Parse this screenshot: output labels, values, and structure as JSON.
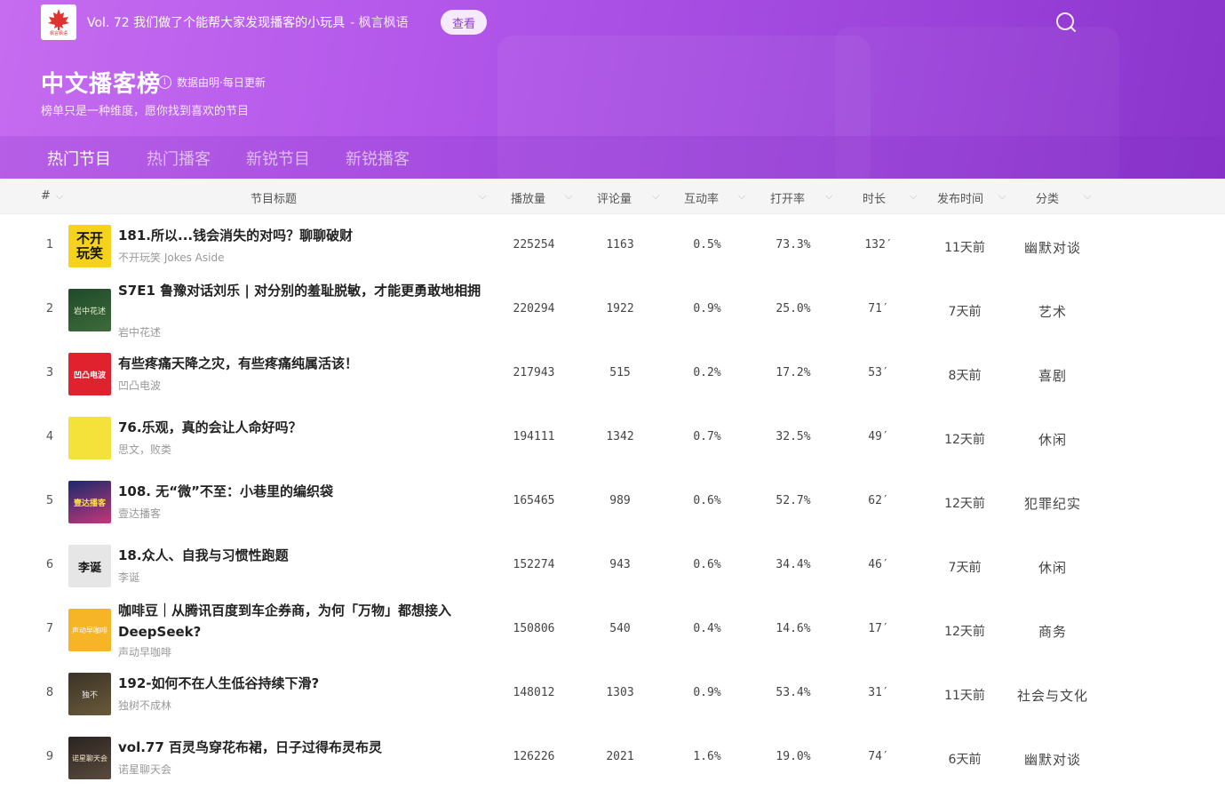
{
  "topbar": {
    "announcement": "Vol. 72 我们做了个能帮大家发现播客的小玩具",
    "announcement_source": "- 枫言枫语",
    "view_button": "查看",
    "logo_text": "枫言枫语"
  },
  "header": {
    "title": "中文播客榜",
    "info_note": "数据由明·每日更新",
    "subtitle": "榜单只是一种维度，愿你找到喜欢的节目"
  },
  "tabs": [
    {
      "label": "热门节目",
      "active": true
    },
    {
      "label": "热门播客",
      "active": false
    },
    {
      "label": "新锐节目",
      "active": false
    },
    {
      "label": "新锐播客",
      "active": false
    }
  ],
  "columns": {
    "rank": "#",
    "title": "节目标题",
    "plays": "播放量",
    "comments": "评论量",
    "engagement": "互动率",
    "open_rate": "打开率",
    "duration": "时长",
    "published": "发布时间",
    "category": "分类"
  },
  "rows": [
    {
      "rank": "1",
      "title": "181.所以...钱会消失的对吗？聊聊破财",
      "podcast": "不开玩笑 Jokes Aside",
      "plays": "225254",
      "comments": "1163",
      "engagement": "0.5%",
      "open_rate": "73.3%",
      "duration": "132′",
      "published": "11天前",
      "category": "幽默对谈",
      "cover": "bukai",
      "cover_text": "不开玩笑"
    },
    {
      "rank": "2",
      "title": "S7E1 鲁豫对话刘乐 | 对分别的羞耻脱敏，才能更勇敢地相拥",
      "podcast": "岩中花述",
      "plays": "220294",
      "comments": "1922",
      "engagement": "0.9%",
      "open_rate": "25.0%",
      "duration": "71′",
      "published": "7天前",
      "category": "艺术",
      "cover": "yanzhong",
      "cover_text": "岩中花述"
    },
    {
      "rank": "3",
      "title": "有些疼痛天降之灾，有些疼痛纯属活该！",
      "podcast": "凹凸电波",
      "plays": "217943",
      "comments": "515",
      "engagement": "0.2%",
      "open_rate": "17.2%",
      "duration": "53′",
      "published": "8天前",
      "category": "喜剧",
      "cover": "aotu",
      "cover_text": "凹凸电波"
    },
    {
      "rank": "4",
      "title": "76.乐观，真的会让人命好吗？",
      "podcast": "思文，败类",
      "plays": "194111",
      "comments": "1342",
      "engagement": "0.7%",
      "open_rate": "32.5%",
      "duration": "49′",
      "published": "12天前",
      "category": "休闲",
      "cover": "siwen",
      "cover_text": ""
    },
    {
      "rank": "5",
      "title": "108. 无“微”不至：小巷里的编织袋",
      "podcast": "壹达播客",
      "plays": "165465",
      "comments": "989",
      "engagement": "0.6%",
      "open_rate": "52.7%",
      "duration": "62′",
      "published": "12天前",
      "category": "犯罪纪实",
      "cover": "yida",
      "cover_text": "壹达播客"
    },
    {
      "rank": "6",
      "title": "18.众人、自我与习惯性跑题",
      "podcast": "李诞",
      "plays": "152274",
      "comments": "943",
      "engagement": "0.6%",
      "open_rate": "34.4%",
      "duration": "46′",
      "published": "7天前",
      "category": "休闲",
      "cover": "lidan",
      "cover_text": "李诞"
    },
    {
      "rank": "7",
      "title": "咖啡豆｜从腾讯百度到车企券商，为何「万物」都想接入DeepSeek?",
      "podcast": "声动早咖啡",
      "plays": "150806",
      "comments": "540",
      "engagement": "0.4%",
      "open_rate": "14.6%",
      "duration": "17′",
      "published": "12天前",
      "category": "商务",
      "cover": "coffee",
      "cover_text": "声动早咖啡"
    },
    {
      "rank": "8",
      "title": "192-如何不在人生低谷持续下滑?",
      "podcast": "独树不成林",
      "plays": "148012",
      "comments": "1303",
      "engagement": "0.9%",
      "open_rate": "53.4%",
      "duration": "31′",
      "published": "11天前",
      "category": "社会与文化",
      "cover": "dushu",
      "cover_text": "独不"
    },
    {
      "rank": "9",
      "title": "vol.77 百灵鸟穿花布裙，日子过得布灵布灵",
      "podcast": "诺星聊天会",
      "plays": "126226",
      "comments": "2021",
      "engagement": "1.6%",
      "open_rate": "19.0%",
      "duration": "74′",
      "published": "6天前",
      "category": "幽默对谈",
      "cover": "nuoxing",
      "cover_text": "诺星聊天会"
    }
  ]
}
